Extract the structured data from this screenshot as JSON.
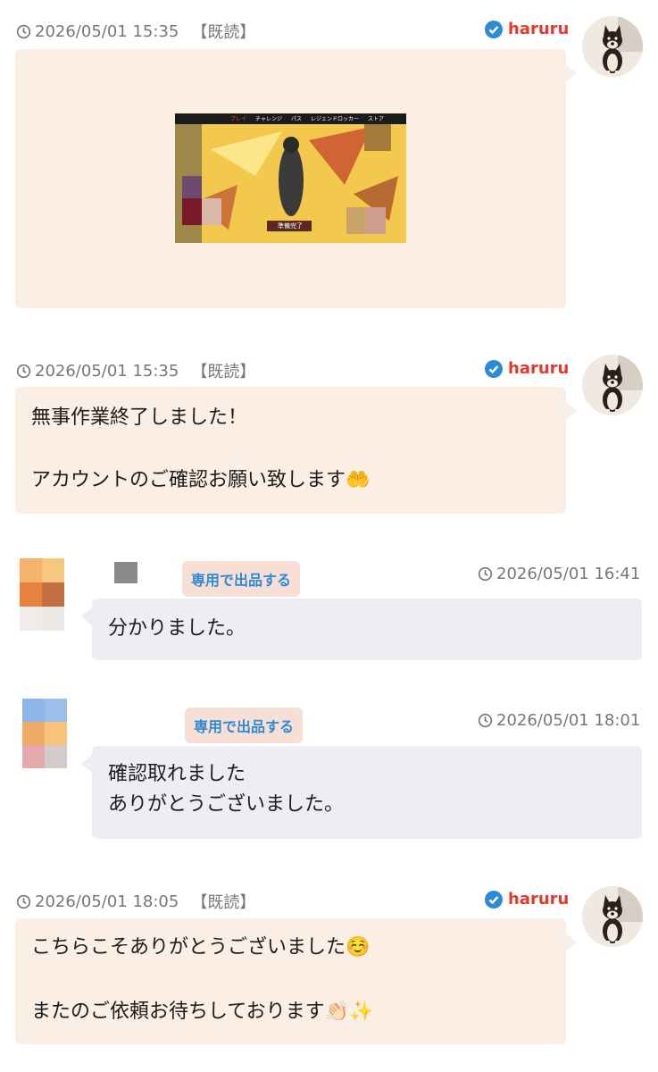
{
  "messages": [
    {
      "time": "2026/05/01 15:35",
      "read_tag": "【既読】",
      "sender": "haruru",
      "image_caption": "準備完了",
      "image_tabs": [
        "プレイ",
        "チャレンジ",
        "パス",
        "レジェンドロッカー",
        "ストア"
      ]
    },
    {
      "time": "2026/05/01 15:35",
      "read_tag": "【既読】",
      "sender": "haruru",
      "line1": "無事作業終了しました！",
      "line2": "アカウントのご確認お願い致します🤲"
    },
    {
      "time": "2026/05/01 16:41",
      "badge": "専用で出品する",
      "text": "分かりました。"
    },
    {
      "time": "2026/05/01 18:01",
      "badge": "専用で出品する",
      "text": "確認取れました\nありがとうございました。"
    },
    {
      "time": "2026/05/01 18:05",
      "read_tag": "【既読】",
      "sender": "haruru",
      "line1": "こちらこそありがとうございました☺️",
      "line2": "またのご依頼お待ちしております👏🏻✨"
    }
  ],
  "colors": {
    "sender": "#e23b2e",
    "verified": "#2d8bd6",
    "bubble_me": "#fbeee4",
    "bubble_other": "#eceef4",
    "badge_bg": "#f8dfd6",
    "badge_text": "#2d8bd6"
  }
}
